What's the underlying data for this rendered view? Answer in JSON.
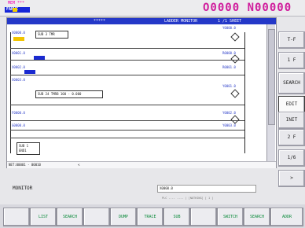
{
  "header": {
    "mode_text": "MEM ***",
    "logo_bar": "FANUC",
    "counter": "O0000 N00000"
  },
  "titlebar": {
    "left": "*****",
    "center": "LADDER MONITOR",
    "right": "1 /1 SHEET"
  },
  "ladder": {
    "labels": [
      "X0000.0",
      "Y0000.0",
      "X0001.0",
      "R0000.0",
      "X0002.0",
      "R0001.0",
      "X0003.0",
      "Y0001.0",
      "F0000.0",
      "Y0002.0",
      "G0000.0",
      "Y0003.0"
    ],
    "fbox1": "SUB 3 TMR",
    "fbox2": "SUB 24 TMRB  100 - 0.000",
    "fbox3": "SUB 1 END1"
  },
  "status": {
    "left": "NET:00001 - 00010",
    "mid": "<"
  },
  "sidebar": {
    "btn1": "T-F",
    "btn2": "1 F",
    "btn3": "SEARCH",
    "btn4": "EDIT",
    "btn5": "INIT",
    "btn6": "2 F",
    "btn7": "1/6",
    "btn8": ">"
  },
  "command": {
    "label": "MONITOR",
    "input_value": "X0000.0",
    "hint": "PLC ---- ---- | [NOTHING] [ 1 ]"
  },
  "softkeys": [
    "",
    "LIST",
    "SEARCH",
    "",
    "DUMP",
    "TRACE",
    "SUB",
    "",
    "SWITCH",
    "SEARCH",
    "ADDR"
  ]
}
